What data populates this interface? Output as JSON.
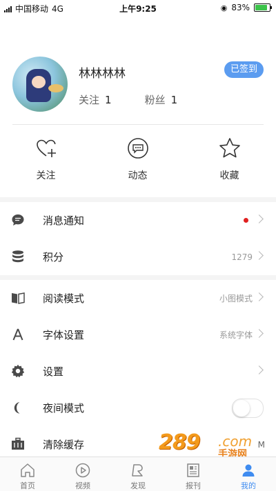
{
  "status_bar": {
    "carrier": "中国移动",
    "network": "4G",
    "time": "上午9:25",
    "battery_text": "83%",
    "battery_level": 0.83
  },
  "profile": {
    "username": "林林林林",
    "checkin_label": "已签到",
    "follow_label": "关注",
    "follow_count": "1",
    "fans_label": "粉丝",
    "fans_count": "1"
  },
  "actions": [
    {
      "label": "关注",
      "icon": "heart-plus-icon"
    },
    {
      "label": "动态",
      "icon": "chat-bubble-icon"
    },
    {
      "label": "收藏",
      "icon": "star-icon"
    }
  ],
  "menu_group_1": [
    {
      "title": "消息通知",
      "icon": "message-icon",
      "has_dot": true
    },
    {
      "title": "积分",
      "icon": "points-database-icon",
      "value": "1279"
    }
  ],
  "menu_group_2": [
    {
      "title": "阅读模式",
      "icon": "book-icon",
      "value": "小图模式"
    },
    {
      "title": "字体设置",
      "icon": "font-icon",
      "value": "系统字体"
    },
    {
      "title": "设置",
      "icon": "gear-icon"
    },
    {
      "title": "夜间模式",
      "icon": "moon-icon",
      "toggle_on": false
    },
    {
      "title": "清除缓存",
      "icon": "briefcase-icon",
      "value": "M"
    }
  ],
  "tabs": [
    {
      "label": "首页",
      "icon": "home-icon"
    },
    {
      "label": "视频",
      "icon": "video-icon"
    },
    {
      "label": "发现",
      "icon": "discover-icon"
    },
    {
      "label": "报刊",
      "icon": "newspaper-icon"
    },
    {
      "label": "我的",
      "icon": "user-icon",
      "active": true
    }
  ],
  "watermark": {
    "number": "289",
    "domain": ".com",
    "site": "手游网"
  },
  "colors": {
    "accent": "#3f8cf0",
    "checkin": "#5b9cf0",
    "red_dot": "#e02020",
    "battery": "#3bc34a"
  }
}
